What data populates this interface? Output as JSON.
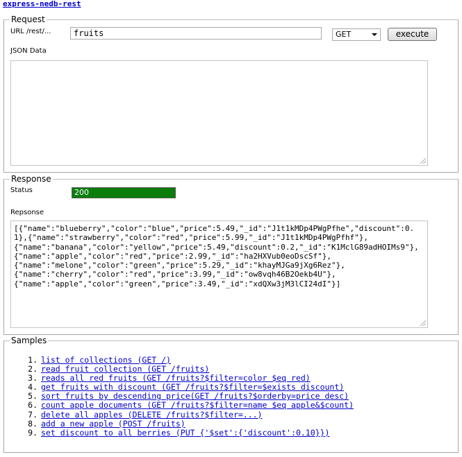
{
  "app": {
    "title": "express-nedb-rest"
  },
  "request": {
    "legend": "Request",
    "url_label": "URL /rest/...",
    "url_value": "fruits",
    "method": "GET",
    "execute_label": "execute",
    "json_label": "JSON Data",
    "json_value": ""
  },
  "response": {
    "legend": "Response",
    "status_label": "Status",
    "status_value": "200",
    "status_color": "#0b7d0b",
    "body_label": "Repsonse",
    "body": "[{\"name\":\"blueberry\",\"color\":\"blue\",\"price\":5.49,\"_id\":\"J1t1kMDp4PWgPfhe\",\"discount\":0.1},{\"name\":\"strawberry\",\"color\":\"red\",\"price\":5.99,\"_id\":\"J1t1kMDp4PWgPfhf\"},\n{\"name\":\"banana\",\"color\":\"yellow\",\"price\":5.49,\"discount\":0.2,\"_id\":\"K1MclG89adHOIMs9\"},{\"name\":\"apple\",\"color\":\"red\",\"price\":2.99,\"_id\":\"ha2HXVub0eoDscSf\"},\n{\"name\":\"melone\",\"color\":\"green\",\"price\":5.29,\"_id\":\"khayMJGa9jXg6Rez\"},\n{\"name\":\"cherry\",\"color\":\"red\",\"price\":3.99,\"_id\":\"ow8vqh46B2Oekb4U\"},\n{\"name\":\"apple\",\"color\":\"green\",\"price\":3.49,\"_id\":\"xdQXw3jM3lCI24dI\"}]"
  },
  "samples": {
    "legend": "Samples",
    "items": [
      {
        "num": "1.",
        "label": "list of collections (GET /)"
      },
      {
        "num": "2.",
        "label": "read fruit collection (GET /fruits)"
      },
      {
        "num": "3.",
        "label": "reads all red fruits (GET /fruits?$filter=color $eq red)"
      },
      {
        "num": "4.",
        "label": "get fruits with discount (GET /fruits?$filter=$exists discount)"
      },
      {
        "num": "5.",
        "label": "sort fruits by descending price(GET /fruits?$orderby=price desc)"
      },
      {
        "num": "6.",
        "label": "count apple documents (GET /fruits?$filter=name $eq apple&$count)"
      },
      {
        "num": "7.",
        "label": "delete all apples (DELETE /fruits?$filter=...)"
      },
      {
        "num": "8.",
        "label": "add a new apple (POST /fruits)"
      },
      {
        "num": "9.",
        "label": "set discount to all berries (PUT {'$set':{'discount':0.10}})"
      }
    ]
  }
}
